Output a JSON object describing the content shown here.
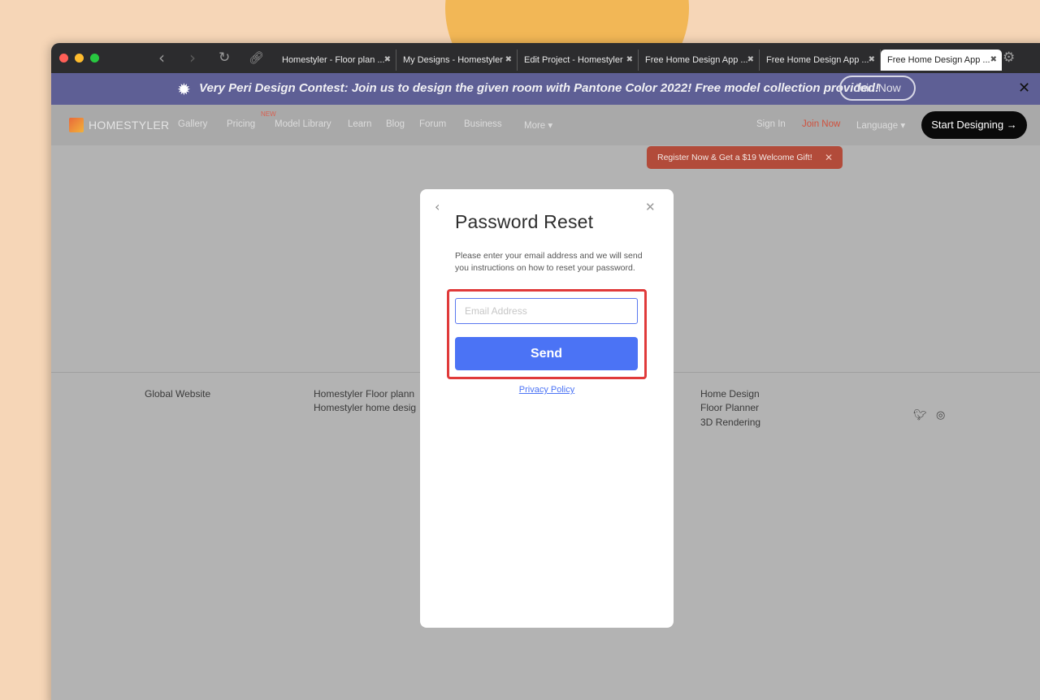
{
  "browser": {
    "tabs": [
      {
        "title": "Homestyler - Floor plan ...",
        "active": false
      },
      {
        "title": "My Designs - Homestyler",
        "active": false
      },
      {
        "title": "Edit Project - Homestyler",
        "active": false
      },
      {
        "title": "Free Home Design App ...",
        "active": false
      },
      {
        "title": "Free Home Design App ...",
        "active": false
      },
      {
        "title": "Free Home Design App ...",
        "active": true
      }
    ],
    "tab_close_glyph": "✖"
  },
  "banner": {
    "text": "Very Peri Design Contest: Join us to design the given room with Pantone Color 2022! Free model collection provided!",
    "button": "Join Now",
    "background_color": "#5e5f95"
  },
  "nav": {
    "logo": "HOMESTYLER",
    "links": [
      "Gallery",
      "Pricing",
      "Model Library",
      "Learn",
      "Blog",
      "Forum",
      "Business",
      "More ▾"
    ],
    "badge": "NEW",
    "sign_in": "Sign In",
    "join_now": "Join Now",
    "language": "Language ▾",
    "start_designing": "Start Designing →"
  },
  "promo": {
    "text": "Register Now & Get a $19 Welcome Gift!",
    "close": "✕"
  },
  "footer": {
    "global_website": "Global Website",
    "col2": [
      "Homestyler Floor plann",
      "Homestyler home desig"
    ],
    "col3": [
      "Home Design",
      "Floor Planner",
      "3D Rendering"
    ]
  },
  "modal": {
    "title": "Password Reset",
    "description": "Please enter your email address and we will send you instructions on how to reset your password.",
    "email_placeholder": "Email Address",
    "email_value": "",
    "send_button": "Send",
    "privacy_link": "Privacy Policy",
    "accent_color": "#4b73f5",
    "highlight_color": "#e03a3a"
  }
}
